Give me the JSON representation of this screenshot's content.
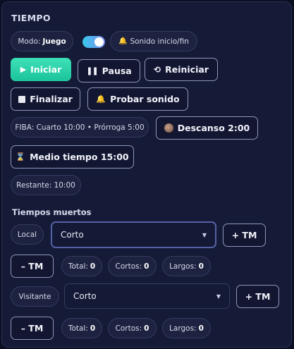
{
  "header": {
    "title": "TIEMPO"
  },
  "mode": {
    "label": "Modo:",
    "value": "Juego",
    "toggle_on": true
  },
  "sound_chip": {
    "icon": "bell-icon",
    "label": "Sonido inicio/fin"
  },
  "controls": {
    "start": {
      "icon": "play-icon",
      "label": "Iniciar"
    },
    "pause": {
      "icon": "pause-icon",
      "label": "Pausa"
    },
    "restart": {
      "icon": "restart-icon",
      "label": "Reiniciar"
    },
    "finish": {
      "icon": "stop-icon",
      "label": "Finalizar"
    },
    "test_sound": {
      "icon": "bell-icon",
      "label": "Probar sonido"
    }
  },
  "rules_chip": {
    "text": "FIBA: Cuarto 10:00 • Prórroga 5:00"
  },
  "break_button": {
    "icon": "break-icon",
    "label": "Descanso 2:00"
  },
  "halftime_button": {
    "icon": "hourglass-icon",
    "label": "Medio tiempo 15:00"
  },
  "remaining_chip": {
    "text": "Restante: 10:00"
  },
  "timeouts": {
    "title": "Tiempos muertos",
    "local": {
      "team_label": "Local",
      "selected": "Corto",
      "add_label": "+ TM",
      "remove_label": "– TM",
      "total_label": "Total:",
      "total": "0",
      "short_label": "Cortos:",
      "short": "0",
      "long_label": "Largos:",
      "long": "0"
    },
    "visitor": {
      "team_label": "Visitante",
      "selected": "Corto",
      "add_label": "+ TM",
      "remove_label": "– TM",
      "total_label": "Total:",
      "total": "0",
      "short_label": "Cortos:",
      "short": "0",
      "long_label": "Largos:",
      "long": "0"
    }
  },
  "colors": {
    "accent": "#2bd6ab",
    "panel": "#151a36",
    "background": "#0b0f23",
    "toggle": "#38c9ea"
  }
}
